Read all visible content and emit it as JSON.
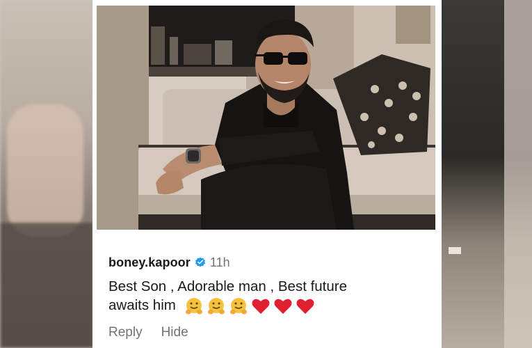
{
  "comment": {
    "username": "boney.kapoor",
    "verified_icon": "verified-badge-icon",
    "time": "11h",
    "text_line1": "Best Son , Adorable man , Best future",
    "text_line2": "awaits him",
    "emojis": [
      "hugging-face-emoji",
      "hugging-face-emoji",
      "hugging-face-emoji",
      "red-heart-emoji",
      "red-heart-emoji",
      "red-heart-emoji"
    ],
    "reply_label": "Reply",
    "hide_label": "Hide"
  },
  "colors": {
    "verified_blue": "#1f9bf0",
    "secondary_text": "#737373",
    "heart_red": "#e0202c",
    "hug_yellow": "#f5c33b"
  }
}
